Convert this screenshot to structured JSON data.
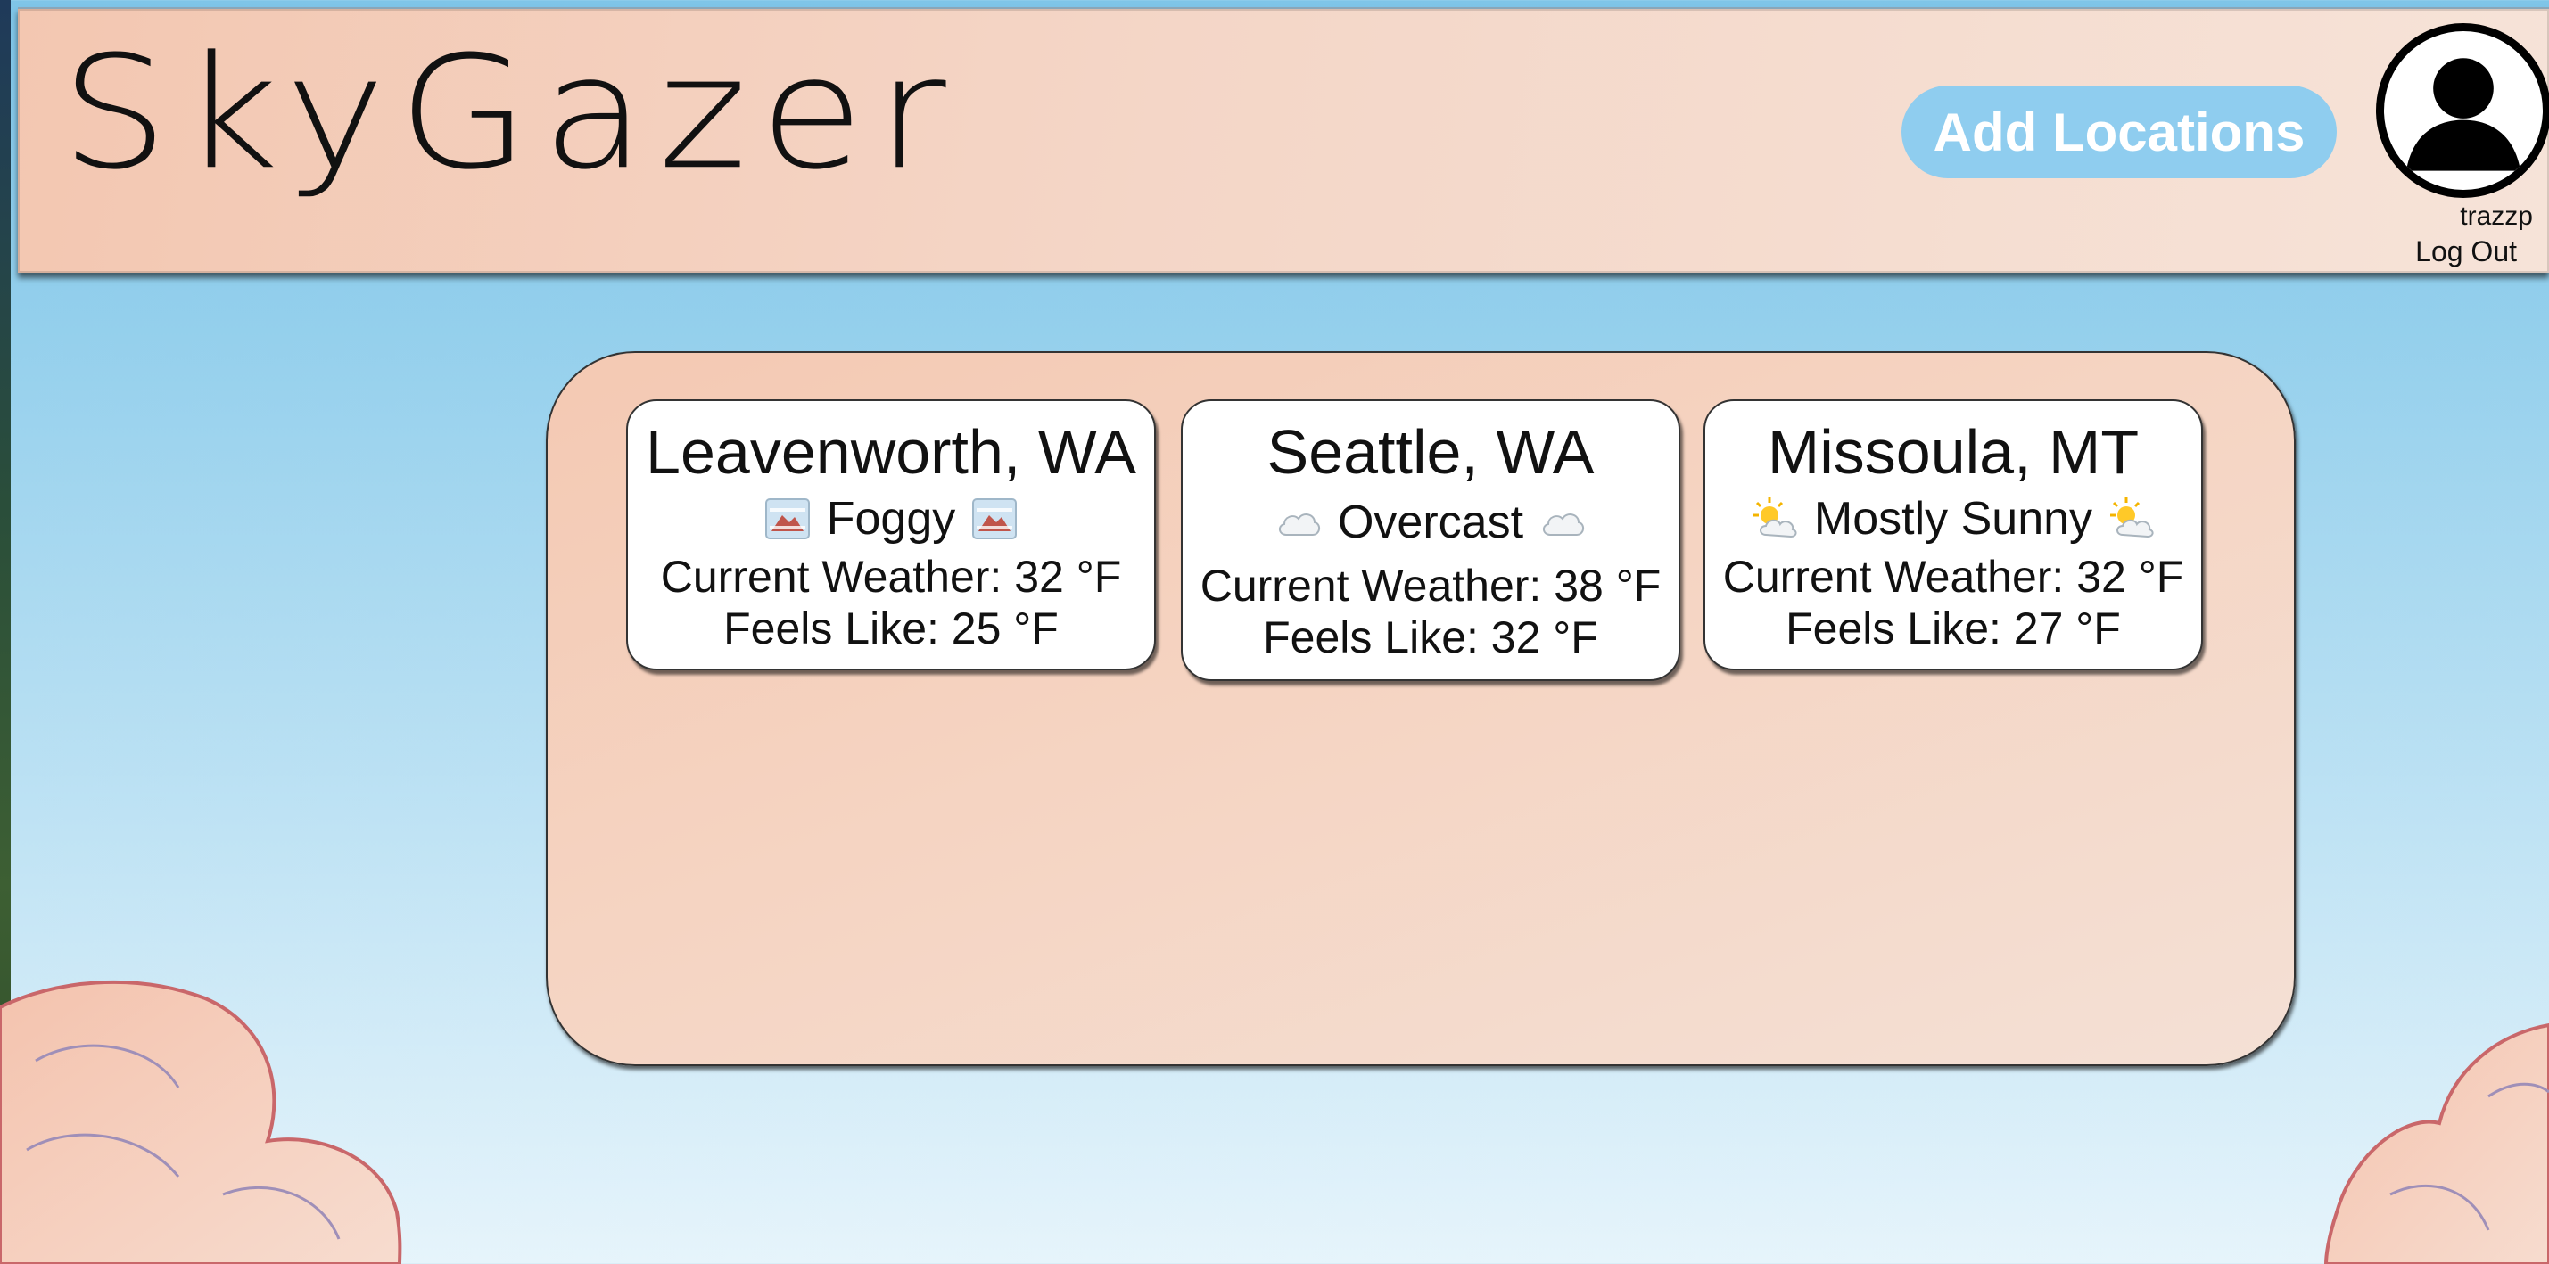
{
  "app": {
    "title": "SkyGazer"
  },
  "header": {
    "add_locations_label": "Add Locations",
    "user": {
      "username": "trazzp",
      "logout_label": "Log Out"
    }
  },
  "locations": [
    {
      "city": "Leavenworth, WA",
      "condition": "Foggy",
      "icon": "foggy-icon",
      "current": "Current Weather: 32 °F",
      "feels_like": "Feels Like: 25 °F"
    },
    {
      "city": "Seattle, WA",
      "condition": "Overcast",
      "icon": "cloud-icon",
      "current": "Current Weather: 38 °F",
      "feels_like": "Feels Like: 32 °F"
    },
    {
      "city": "Missoula, MT",
      "condition": "Mostly Sunny",
      "icon": "sun-behind-cloud-icon",
      "current": "Current Weather: 32 °F",
      "feels_like": "Feels Like: 27 °F"
    }
  ],
  "colors": {
    "header_bg": "#f4d6c7",
    "button_bg": "#8fcdef",
    "sky_top": "#7fc5e8",
    "sky_bottom": "#e6f4fb",
    "panel_bg": "#f5d4c2"
  }
}
